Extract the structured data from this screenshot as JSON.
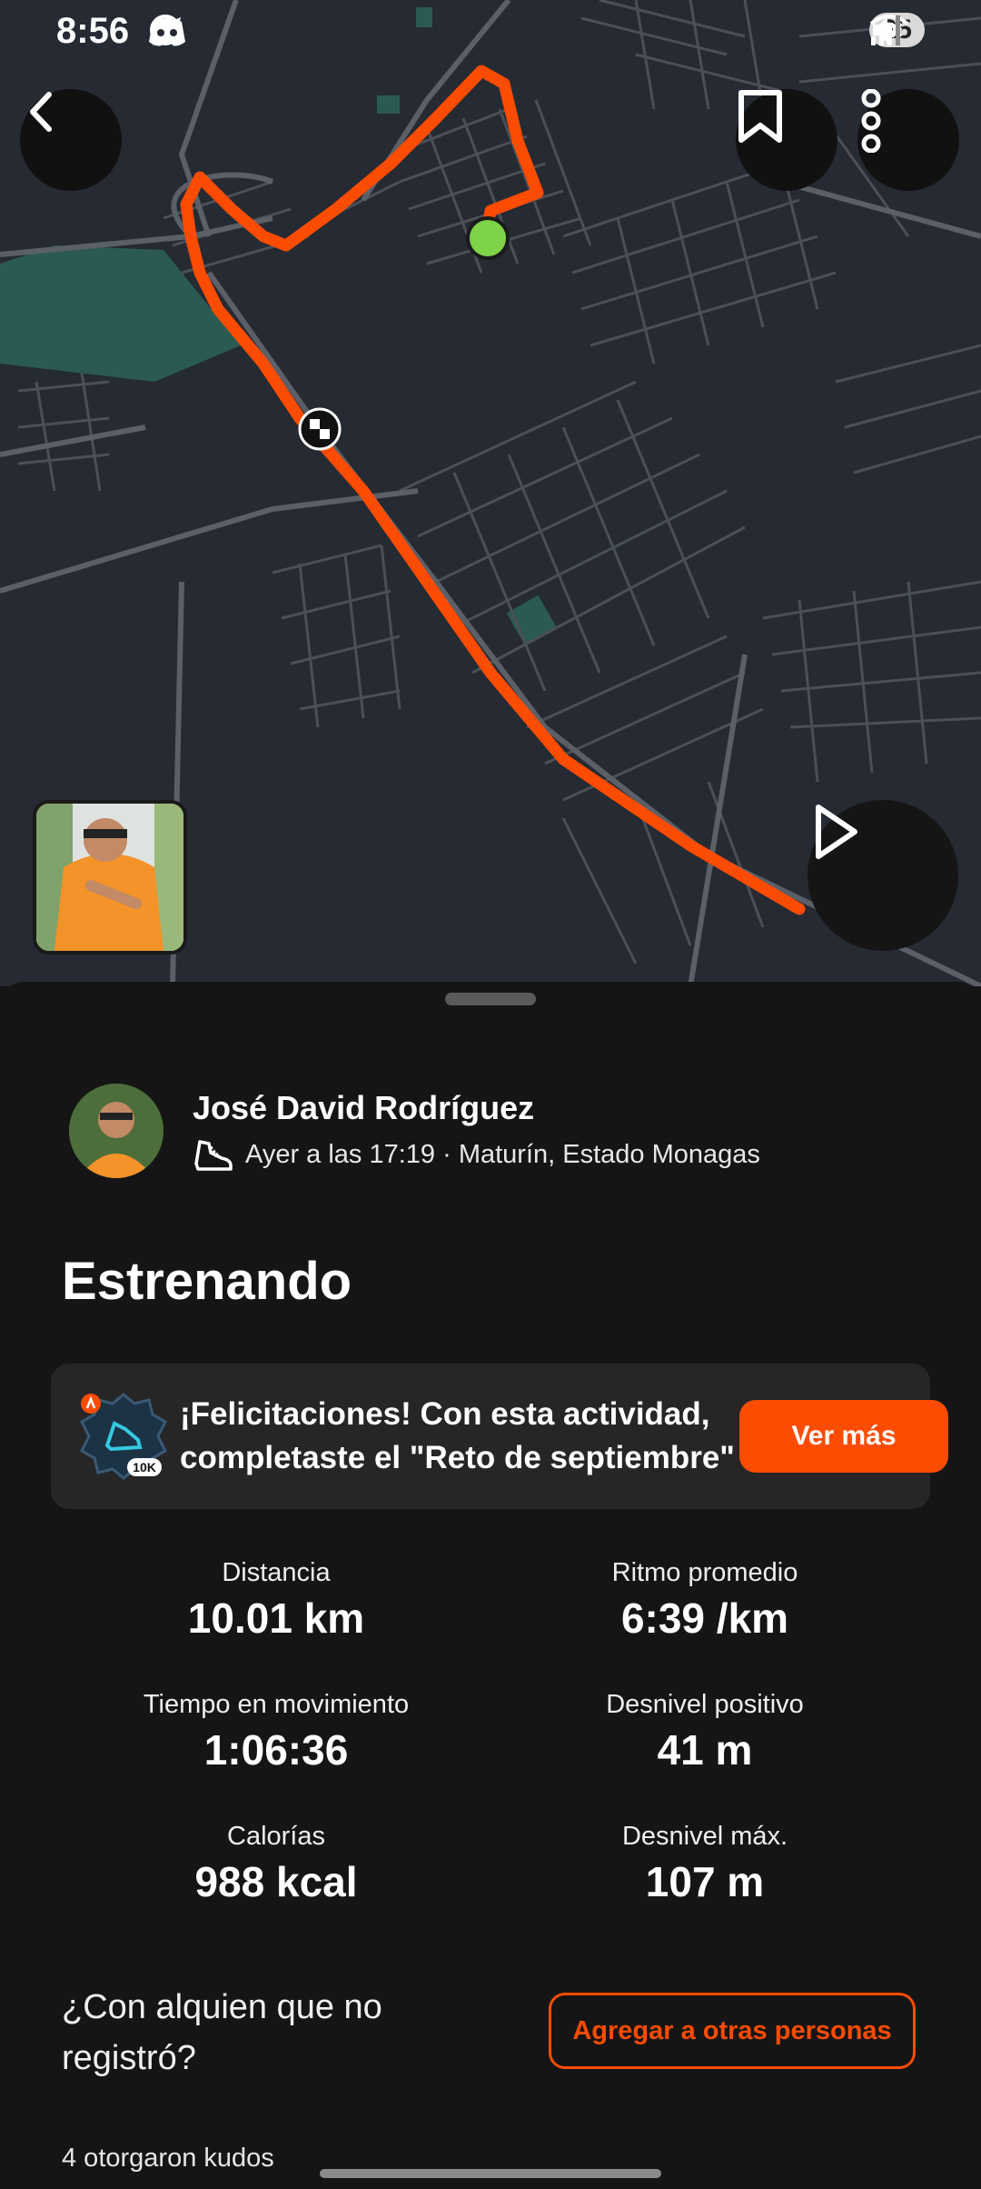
{
  "status_bar": {
    "time": "8:56",
    "battery": "25",
    "notification_icons": [
      "whatsapp-icon",
      "telegram-icon",
      "discord-icon"
    ],
    "system_icons": [
      "mute-icon",
      "wifi-icon",
      "signal-icon"
    ]
  },
  "map": {
    "colors": {
      "route": "#fc4c02",
      "start": "#7ed348",
      "background": "#252a33",
      "roads": "#50555f",
      "parks": "#2a5a52"
    }
  },
  "athlete": {
    "name": "José David Rodríguez",
    "meta": "Ayer a las 17:19 · Maturín, Estado Monagas",
    "activity_icon": "running-shoe-icon"
  },
  "activity": {
    "title": "Estrenando"
  },
  "banner": {
    "line1": "¡Felicitaciones! Con esta actividad,",
    "line2": "completaste el \"Reto de septiembre\"",
    "badge_label": "10K",
    "button": "Ver más"
  },
  "stats": [
    {
      "label": "Distancia",
      "value": "10.01 km"
    },
    {
      "label": "Ritmo promedio",
      "value": "6:39 /km"
    },
    {
      "label": "Tiempo en movimiento",
      "value": "1:06:36"
    },
    {
      "label": "Desnivel positivo",
      "value": "41 m"
    },
    {
      "label": "Calorías",
      "value": "988 kcal"
    },
    {
      "label": "Desnivel máx.",
      "value": "107 m"
    }
  ],
  "tag_prompt": {
    "line1": "¿Con alquien que no",
    "line2": "registró?",
    "button": "Agregar a otras personas"
  },
  "kudos": "4 otorgaron kudos",
  "accent_color": "#fc4c02"
}
